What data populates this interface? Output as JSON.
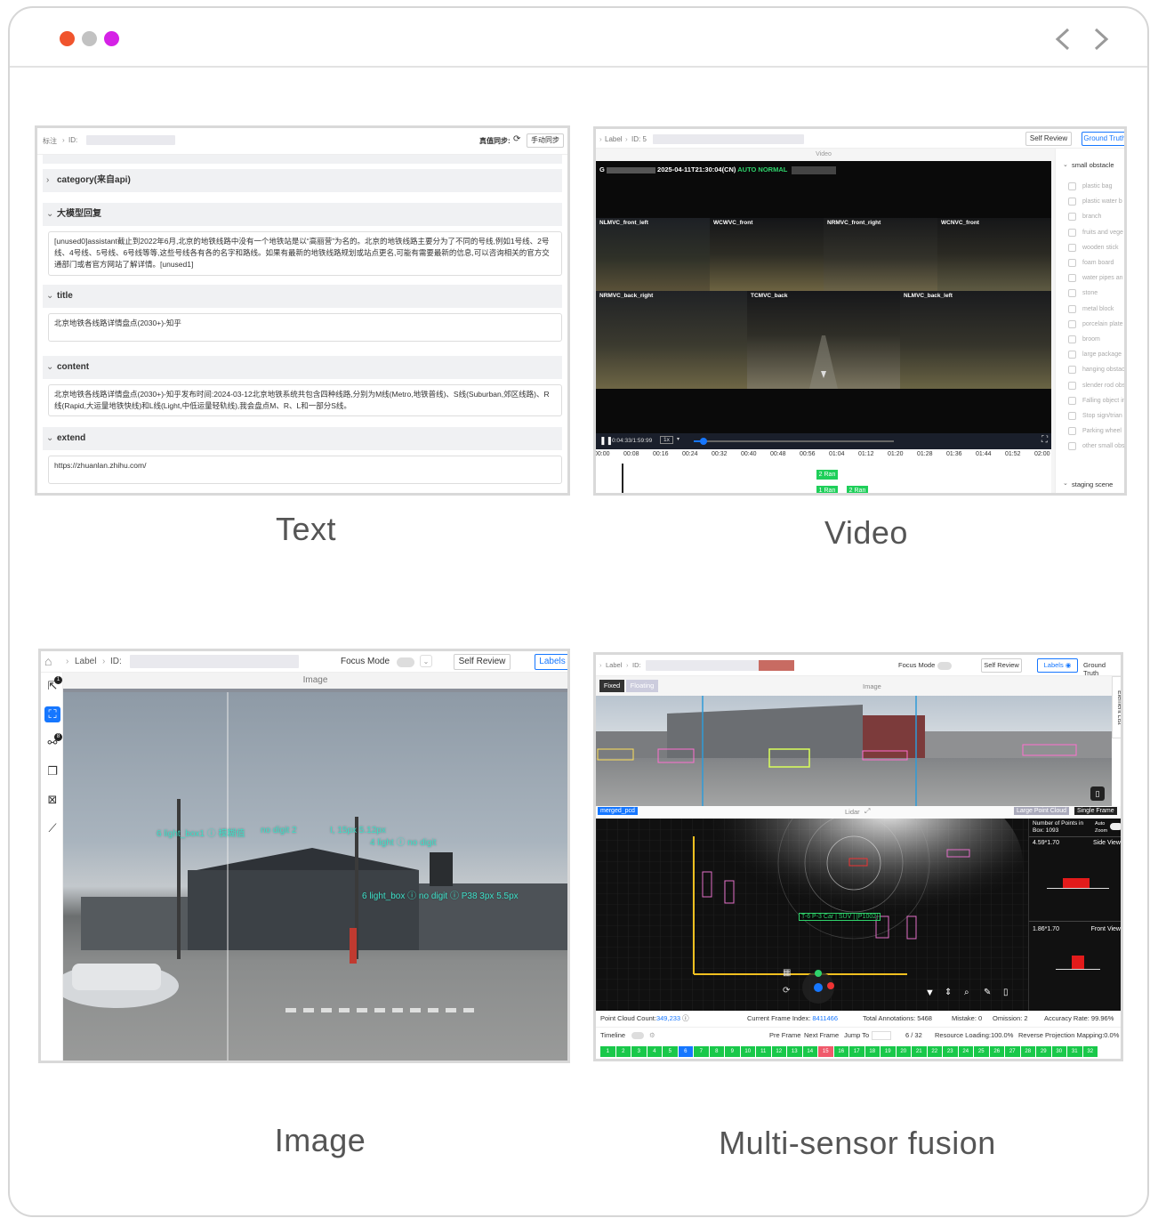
{
  "window": {
    "dots": [
      "#f0542d",
      "#c2c2c2",
      "#d522e6"
    ],
    "back_icon": "chevron-left-icon",
    "forward_icon": "chevron-right-icon"
  },
  "captions": {
    "text": "Text",
    "video": "Video",
    "image": "Image",
    "msf": "Multi-sensor fusion"
  },
  "text_panel": {
    "breadcrumb_root": "标注",
    "breadcrumb_id": "ID:",
    "sync_status": "真值同步:",
    "manual_sync": "手动同步",
    "sections": [
      {
        "title": "category(来自api)",
        "collapsed": true,
        "body": ""
      },
      {
        "title": "大模型回复",
        "collapsed": false,
        "body": "[unused0]assistant截止到2022年6月,北京的地铁线路中没有一个地铁站是以“高丽营”为名的。北京的地铁线路主要分为了不同的号线,例如1号线、2号线、4号线、5号线、6号线等等,这些号线各有各的名字和路线。如果有最新的地铁线路规划或站点更名,可能有需要最新的信息,可以咨询相关的官方交通部门或者官方网站了解详情。[unused1]"
      },
      {
        "title": "title",
        "collapsed": false,
        "body": "北京地铁各线路详情盘点(2030+)-知乎"
      },
      {
        "title": "content",
        "collapsed": false,
        "body": "北京地铁各线路详情盘点(2030+)-知乎发布时间:2024-03-12北京地铁系统共包含四种线路,分别为M线(Metro,地铁普线)、S线(Suburban,郊区线路)、R线(Rapid,大运量地铁快线)和L线(Light,中低运量轻轨线),我会盘点M、R、L和一部分S线。"
      },
      {
        "title": "extend",
        "collapsed": false,
        "body": "https://zhuanlan.zhihu.com/"
      }
    ]
  },
  "video_panel": {
    "breadcrumb": "Label",
    "id_label": "ID: 5",
    "self_review": "Self Review",
    "ground_truth": "Ground Truth",
    "view_title": "Video",
    "overlay_time": "2025-04-11T21:30:04(CN)",
    "overlay_mode": "AUTO NORMAL",
    "overlay_prefix": "G",
    "cameras_top": [
      "NLMVC_front_left",
      "WCWVC_front",
      "NRMVC_front_right",
      "WCNVC_front"
    ],
    "cameras_bottom": [
      "NRMVC_back_right",
      "TCMVC_back",
      "NLMVC_back_left"
    ],
    "playback_time": "0:04:33/1:59:99",
    "speed": "1x",
    "playback_progress": 0.05,
    "timeline_ticks": [
      "00:00",
      "00:08",
      "00:16",
      "00:24",
      "00:32",
      "00:40",
      "00:48",
      "00:56",
      "01:04",
      "01:12",
      "01:20",
      "01:28",
      "01:36",
      "01:44",
      "01:52",
      "02:00"
    ],
    "track_labels": [
      "2 Ran",
      "1 Ran",
      "2 Ran"
    ],
    "sidebar_group": "small obstacle",
    "sidebar_items": [
      "plastic bag",
      "plastic water b",
      "branch",
      "fruits and vege shells, etc.)",
      "wooden stick",
      "foam board",
      "water pipes an",
      "stone",
      "metal block",
      "porcelain plate",
      "broom",
      "large package",
      "hanging obstac",
      "slender rod obs",
      "Falling object in",
      "Stop sign/trian",
      "Parking wheel",
      "other small obs"
    ],
    "sidebar_group2": "staging scene"
  },
  "image_panel": {
    "breadcrumb": "Label",
    "id_label": "ID:",
    "focus_mode": "Focus Mode",
    "self_review": "Self Review",
    "labels_btn": "Labels",
    "view_title": "Image",
    "tool_badges": [
      "1",
      "8"
    ],
    "tools": [
      "pointer-icon",
      "bounding-box-icon",
      "polyline-tool-icon",
      "copy-icon",
      "delete-box-icon",
      "ruler-icon"
    ],
    "annotations": [
      "6 light_box1 ⓘ 模糊值",
      "no digit 2",
      "I, 15px 5.12px",
      "4 light ⓘ no digit",
      "6 light_box ⓘ no digit ⓘ P38 3px 5.5px"
    ]
  },
  "msf_panel": {
    "breadcrumb": "Label",
    "id_label": "ID:",
    "focus_mode": "Focus Mode",
    "self_review": "Self Review",
    "labels_btn": "Labels",
    "ground_truth": "Ground Truth",
    "fixed": "Fixed",
    "floating": "Floating",
    "image_title": "Image",
    "element_list": "Element List",
    "pcd_tag": "merged_pcd",
    "lidar_title": "Lidar",
    "large_cloud": "Large Point Cloud",
    "single_frame": "Single Frame",
    "points_in_box": "Number of Points in Box: 1093",
    "auto_zoom": "Auto Zoom",
    "side_dim": "4.59*1.70",
    "side_title": "Side View",
    "front_dim": "1.86*1.70",
    "front_title": "Front View",
    "selected_label": "T-6 P-3 Car | SUV | [P1002]",
    "point_count_label": "Point Cloud Count:",
    "point_count": "349,233",
    "current_frame_label": "Current Frame Index:",
    "current_frame": "8411466",
    "total_annotations": "Total Annotations: 5468",
    "mistake": "Mistake: 0",
    "omission": "Omission: 2",
    "accuracy": "Accuracy Rate: 99.96%",
    "timeline": "Timeline",
    "pre_frame": "Pre Frame",
    "next_frame": "Next Frame",
    "jump_to": "Jump To",
    "frame_pos": "6 / 32",
    "resource_loading": "Resource Loading:100.0%",
    "reverse_projection": "Reverse Projection Mapping:0.0%",
    "frames": [
      "1",
      "2",
      "3",
      "4",
      "5",
      "6",
      "7",
      "8",
      "9",
      "10",
      "11",
      "12",
      "13",
      "14",
      "15",
      "16",
      "17",
      "18",
      "19",
      "20",
      "21",
      "22",
      "23",
      "24",
      "25",
      "26",
      "27",
      "28",
      "29",
      "30",
      "31",
      "32"
    ],
    "active_frame": 6,
    "error_frame": 15,
    "colors": {
      "ok": "#19c84a",
      "active": "#1677ff",
      "error": "#f05a6b"
    }
  }
}
